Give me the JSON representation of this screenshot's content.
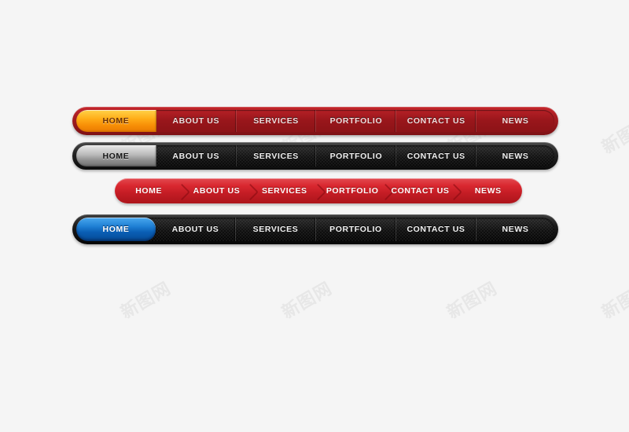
{
  "page": {
    "background_color": "#f5f5f5",
    "watermark_text": "新图网"
  },
  "navbars": [
    {
      "id": "bar-red-orange",
      "style_name": "red-glossy-bar",
      "accent_color": "#f78d06",
      "bar_color": "#a01b20",
      "active_index": 0,
      "items": [
        {
          "label": "HOME",
          "flex": 101
        },
        {
          "label": "ABOUT US",
          "flex": 101
        },
        {
          "label": "SERVICES",
          "flex": 101
        },
        {
          "label": "PORTFOLIO",
          "flex": 101
        },
        {
          "label": "CONTACT US",
          "flex": 101
        },
        {
          "label": "NEWS",
          "flex": 99
        }
      ]
    },
    {
      "id": "bar-black-silver",
      "style_name": "black-carbon-bar",
      "accent_color": "#b9b9b9",
      "bar_color": "#131313",
      "active_index": 0,
      "items": [
        {
          "label": "HOME",
          "flex": 101
        },
        {
          "label": "ABOUT US",
          "flex": 101
        },
        {
          "label": "SERVICES",
          "flex": 101
        },
        {
          "label": "PORTFOLIO",
          "flex": 101
        },
        {
          "label": "CONTACT US",
          "flex": 101
        },
        {
          "label": "NEWS",
          "flex": 99
        }
      ]
    },
    {
      "id": "bar-red-chevron",
      "style_name": "red-chevron-bar",
      "accent_color": "#d9272f",
      "bar_color": "#c21c24",
      "active_index": -1,
      "items": [
        {
          "label": "HOME",
          "flex": 100
        },
        {
          "label": "ABOUT US",
          "flex": 100
        },
        {
          "label": "SERVICES",
          "flex": 100
        },
        {
          "label": "PORTFOLIO",
          "flex": 100
        },
        {
          "label": "CONTACT US",
          "flex": 100
        },
        {
          "label": "NEWS",
          "flex": 100
        }
      ]
    },
    {
      "id": "bar-black-blue",
      "style_name": "black-carbon-blue-bar",
      "accent_color": "#1e7fd4",
      "bar_color": "#101010",
      "active_index": 0,
      "items": [
        {
          "label": "HOME",
          "flex": 101
        },
        {
          "label": "ABOUT US",
          "flex": 101
        },
        {
          "label": "SERVICES",
          "flex": 101
        },
        {
          "label": "PORTFOLIO",
          "flex": 101
        },
        {
          "label": "CONTACT US",
          "flex": 101
        },
        {
          "label": "NEWS",
          "flex": 99
        }
      ]
    }
  ]
}
